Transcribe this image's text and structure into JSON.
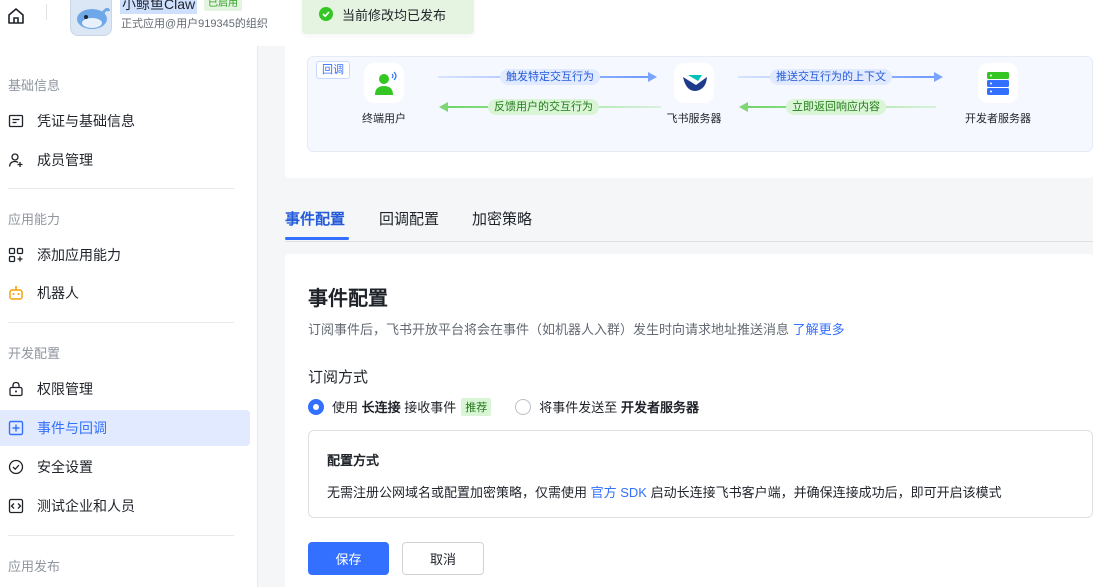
{
  "header": {
    "app_name": "小鲸鱼Claw",
    "app_status": "已启用",
    "app_sub": "正式应用@用户919345的组织",
    "toast": "当前修改均已发布"
  },
  "sidebar": {
    "sections": [
      {
        "title": "基础信息"
      },
      {
        "title": "应用能力"
      },
      {
        "title": "开发配置"
      },
      {
        "title": "应用发布"
      }
    ],
    "items": [
      {
        "label": "凭证与基础信息",
        "icon": "credential-icon"
      },
      {
        "label": "成员管理",
        "icon": "user-add-icon"
      },
      {
        "label": "添加应用能力",
        "icon": "grid-add-icon"
      },
      {
        "label": "机器人",
        "icon": "robot-icon"
      },
      {
        "label": "权限管理",
        "icon": "lock-icon"
      },
      {
        "label": "事件与回调",
        "icon": "event-icon",
        "active": true
      },
      {
        "label": "安全设置",
        "icon": "shield-check-icon"
      },
      {
        "label": "测试企业和人员",
        "icon": "code-box-icon"
      }
    ]
  },
  "flow": {
    "tag": "回调",
    "nodes": [
      "终端用户",
      "飞书服务器",
      "开发者服务器"
    ],
    "arrows": [
      "触发特定交互行为",
      "反馈用户的交互行为",
      "推送交互行为的上下文",
      "立即返回响应内容"
    ]
  },
  "tabs": [
    "事件配置",
    "回调配置",
    "加密策略"
  ],
  "config": {
    "title": "事件配置",
    "desc": "订阅事件后，飞书开放平台将会在事件（如机器人入群）发生时向请求地址推送消息",
    "desc_link": "了解更多",
    "sub_title": "订阅方式",
    "option1_pre": "使用",
    "option1_bold": "长连接",
    "option1_post": "接收事件",
    "option1_badge": "推荐",
    "option2_pre": "将事件发送至",
    "option2_bold": "开发者服务器",
    "mode_title": "配置方式",
    "mode_desc_pre": "无需注册公网域名或配置加密策略，仅需使用",
    "mode_desc_link": "官方 SDK",
    "mode_desc_post": "启动长连接飞书客户端，并确保连接成功后，即可开启该模式",
    "save": "保存",
    "cancel": "取消"
  },
  "colors": {
    "accent": "#3370ff",
    "success": "#34c724"
  }
}
